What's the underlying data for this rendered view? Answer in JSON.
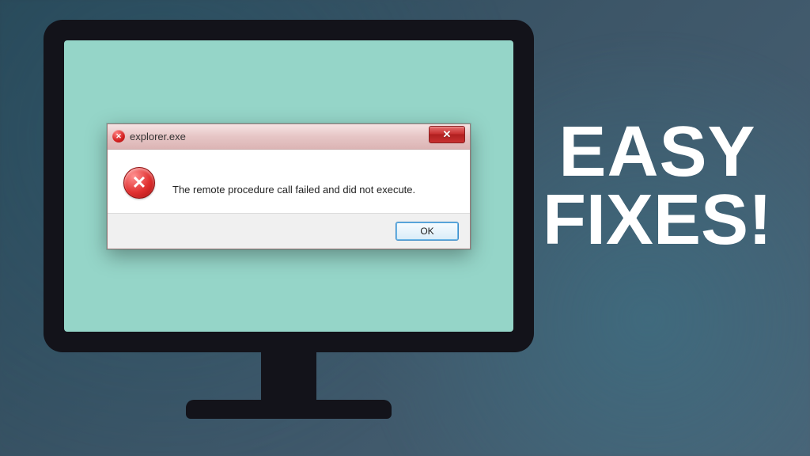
{
  "dialog": {
    "title": "explorer.exe",
    "message": "The remote procedure call failed and did not execute.",
    "ok_label": "OK"
  },
  "headline": {
    "line1": "EASY",
    "line2": "FIXES!"
  },
  "icons": {
    "titlebar_error": "error-small-icon",
    "body_error": "error-icon",
    "close": "close-icon"
  },
  "colors": {
    "screen_bg": "#95d5c8",
    "bezel": "#13131a",
    "close_red": "#c83030",
    "ok_border": "#3b8bc8"
  }
}
